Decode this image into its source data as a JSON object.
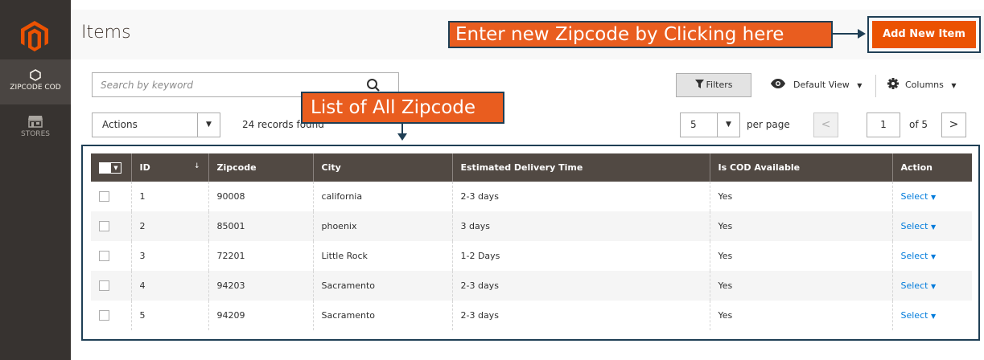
{
  "sidebar": {
    "items": [
      {
        "label": "ZIPCODE COD",
        "icon": "hexagon-icon",
        "active": true
      },
      {
        "label": "STORES",
        "icon": "store-icon",
        "active": false
      }
    ]
  },
  "header": {
    "title": "Items"
  },
  "callouts": {
    "add_hint": "Enter new Zipcode by Clicking here",
    "list_hint": "List of All Zipcode"
  },
  "toolbar": {
    "add_button": "Add New Item",
    "search_placeholder": "Search by keyword",
    "filters": "Filters",
    "view": "Default View",
    "columns": "Columns",
    "actions": "Actions",
    "records": "24 records found",
    "per_page_value": "5",
    "per_page_label": "per page",
    "page_current": "1",
    "page_total": "of 5",
    "prev": "<",
    "next": ">"
  },
  "grid": {
    "columns": [
      "ID",
      "Zipcode",
      "City",
      "Estimated Delivery Time",
      "Is COD Available",
      "Action"
    ],
    "sort_indicator": "↓",
    "rows": [
      {
        "id": "1",
        "zipcode": "90008",
        "city": "california",
        "delivery": "2-3 days",
        "cod": "Yes",
        "action": "Select"
      },
      {
        "id": "2",
        "zipcode": "85001",
        "city": "phoenix",
        "delivery": "3 days",
        "cod": "Yes",
        "action": "Select"
      },
      {
        "id": "3",
        "zipcode": "72201",
        "city": "Little Rock",
        "delivery": "1-2 Days",
        "cod": "Yes",
        "action": "Select"
      },
      {
        "id": "4",
        "zipcode": "94203",
        "city": "Sacramento",
        "delivery": "2-3 days",
        "cod": "Yes",
        "action": "Select"
      },
      {
        "id": "5",
        "zipcode": "94209",
        "city": "Sacramento",
        "delivery": "2-3 days",
        "cod": "Yes",
        "action": "Select"
      }
    ]
  },
  "colors": {
    "sidebar_bg": "#373330",
    "accent": "#eb5202",
    "callout": "#e95d1f",
    "callout_border": "#1f3f55",
    "grid_header": "#514943",
    "link": "#007bdb"
  }
}
